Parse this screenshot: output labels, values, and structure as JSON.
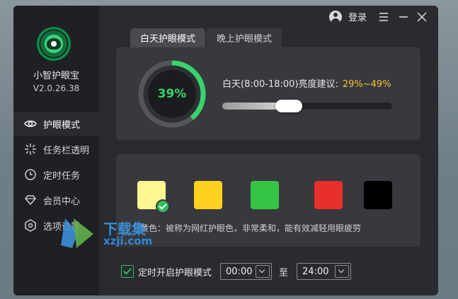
{
  "app": {
    "name": "小智护眼宝",
    "version": "V2.0.26.38"
  },
  "sidebar": {
    "items": [
      {
        "label": "护眼模式",
        "icon": "eye-icon",
        "active": true
      },
      {
        "label": "任务栏透明",
        "icon": "sparkle-icon",
        "active": false
      },
      {
        "label": "定时任务",
        "icon": "clock-icon",
        "active": false
      },
      {
        "label": "会员中心",
        "icon": "diamond-icon",
        "active": false
      },
      {
        "label": "选项设置",
        "icon": "gear-icon",
        "active": false
      }
    ]
  },
  "topbar": {
    "login_label": "登录"
  },
  "tabs": [
    {
      "label": "白天护眼模式",
      "active": true
    },
    {
      "label": "晚上护眼模式",
      "active": false
    }
  ],
  "brightness": {
    "percent_label": "39%",
    "percent": 39,
    "suggestion_label": "白天(8:00-18:00)亮度建议:",
    "suggestion_value": "29%~49%",
    "slider_value": 39
  },
  "colors": {
    "swatches": [
      {
        "name": "cream",
        "color": "#FFF68F",
        "selected": true
      },
      {
        "name": "yellow",
        "color": "#FFD21F",
        "selected": false
      },
      {
        "name": "green",
        "color": "#36C445",
        "selected": false
      },
      {
        "name": "red",
        "color": "#E8302A",
        "selected": false
      },
      {
        "name": "black",
        "color": "#000000",
        "selected": false
      }
    ],
    "description": "黄色：被称为网红护眼色，非常柔和，能有效减轻用眼疲劳"
  },
  "timer": {
    "checkbox_label": "定时开启护眼模式",
    "checked": true,
    "start_time": "00:00",
    "to_label": "至",
    "end_time": "24:00"
  },
  "watermark": {
    "text": "下载集",
    "url": "xzji.com"
  },
  "accent": {
    "green": "#37D36B",
    "yellow": "#F2C42D"
  }
}
